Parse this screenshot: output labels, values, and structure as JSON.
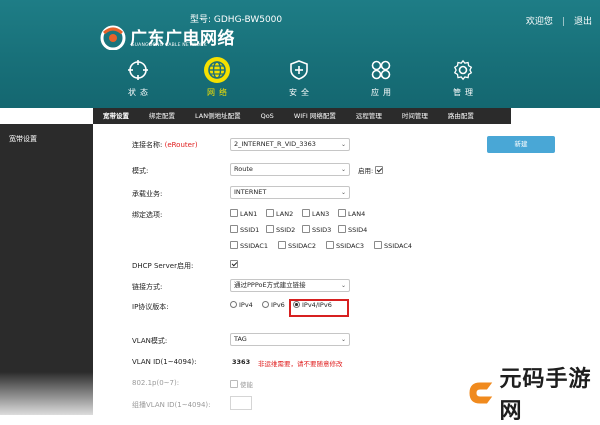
{
  "header": {
    "logo_cn": "广东广电网络",
    "logo_en": "GUANGDONG CABLE NETWORK",
    "model_label": "型号: GDHG-BW5000",
    "welcome": "欢迎您",
    "logout": "退出",
    "separator": "|"
  },
  "nav": [
    {
      "label": "状态",
      "icon": "status-icon"
    },
    {
      "label": "网络",
      "icon": "globe-icon"
    },
    {
      "label": "安全",
      "icon": "shield-icon"
    },
    {
      "label": "应用",
      "icon": "apps-icon"
    },
    {
      "label": "管理",
      "icon": "gear-icon"
    }
  ],
  "subtabs": [
    "宽带设置",
    "绑定配置",
    "LAN侧地址配置",
    "QoS",
    "WIFI 网络配置",
    "远程管理",
    "时间管理",
    "路由配置"
  ],
  "sidebar": {
    "item": "宽带设置"
  },
  "form": {
    "conn_name_label": "连接名称:",
    "conn_name_hint": "(eRouter)",
    "conn_name_value": "2_INTERNET_R_VID_3363",
    "mode_label": "模式:",
    "mode_value": "Route",
    "enable_label": "启用:",
    "service_label": "承载业务:",
    "service_value": "INTERNET",
    "bind_label": "绑定选项:",
    "bind_options": [
      "LAN1",
      "LAN2",
      "LAN3",
      "LAN4",
      "SSID1",
      "SSID2",
      "SSID3",
      "SSID4",
      "SSIDAC1",
      "SSIDAC2",
      "SSIDAC3",
      "SSIDAC4"
    ],
    "dhcp_label": "DHCP Server启用:",
    "link_label": "链接方式:",
    "link_value": "通过PPPoE方式建立链接",
    "ip_label": "IP协议版本:",
    "ip_options": [
      "IPv4",
      "IPv6",
      "IPv4/IPv6"
    ],
    "vlan_mode_label": "VLAN模式:",
    "vlan_mode_value": "TAG",
    "vlan_id_label": "VLAN ID(1~4094):",
    "vlan_id_value": "3363",
    "vlan_note": "非运维需要，请不要随意修改",
    "p8021_label": "802.1p(0~7):",
    "p8021_enable": "使能",
    "bind_vlan_label": "组播VLAN ID(1~4094):",
    "new_button": "新建"
  },
  "watermark": {
    "text": "元码手游网"
  }
}
